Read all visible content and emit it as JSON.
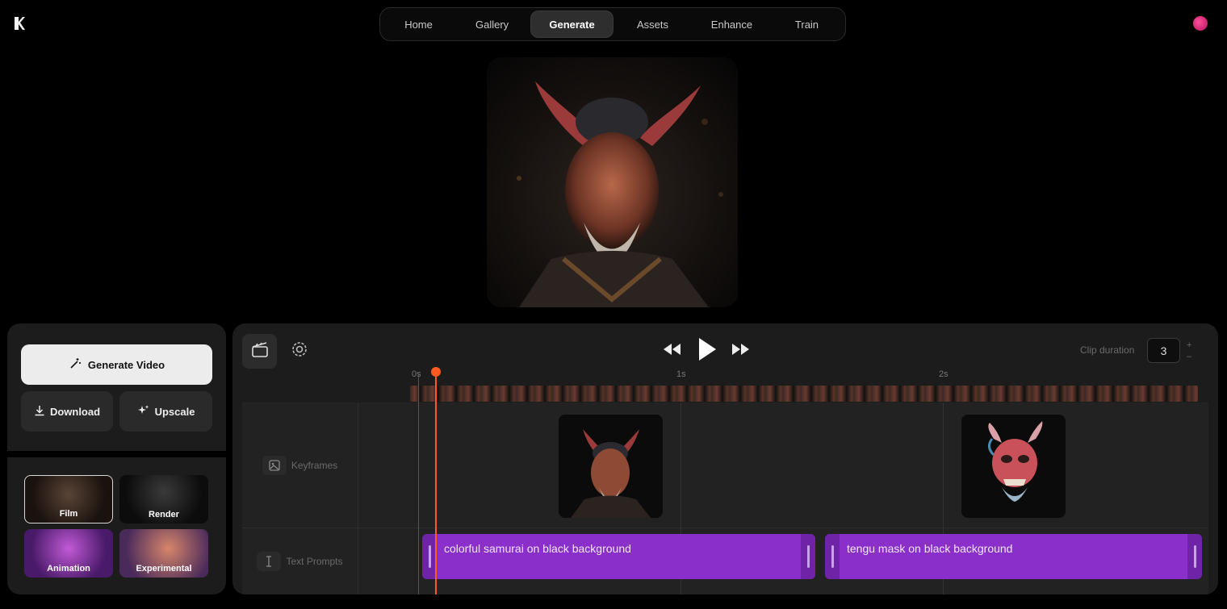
{
  "nav": {
    "items": [
      "Home",
      "Gallery",
      "Generate",
      "Assets",
      "Enhance",
      "Train"
    ],
    "active": "Generate"
  },
  "icons": {
    "logo": "app-logo-icon",
    "avatar": "user-avatar",
    "wand": "magic-wand-icon",
    "download": "download-icon",
    "upscale": "sparkle-icon",
    "clapper": "clapperboard-icon",
    "settings": "gear-icon",
    "rewind": "rewind-icon",
    "play": "play-icon",
    "forward": "fast-forward-icon",
    "image": "image-icon",
    "text": "text-cursor-icon"
  },
  "actions": {
    "generate_video": "Generate Video",
    "download": "Download",
    "upscale": "Upscale"
  },
  "styles": [
    "Film",
    "Render",
    "Animation",
    "Experimental"
  ],
  "selected_style": "Film",
  "timeline": {
    "clip_duration_label": "Clip duration",
    "clip_duration_value": "3",
    "stepper_plus": "+",
    "stepper_minus": "–",
    "ruler": [
      "0s",
      "1s",
      "2s"
    ],
    "tracks": {
      "keyframes_label": "Keyframes",
      "text_prompts_label": "Text Prompts"
    },
    "prompts": [
      "colorful samurai on black background",
      "tengu mask on black background"
    ]
  },
  "colors": {
    "accent_playhead": "#ff5a1f",
    "prompt_clip": "#8a2fc9",
    "avatar": "#e0307a"
  }
}
